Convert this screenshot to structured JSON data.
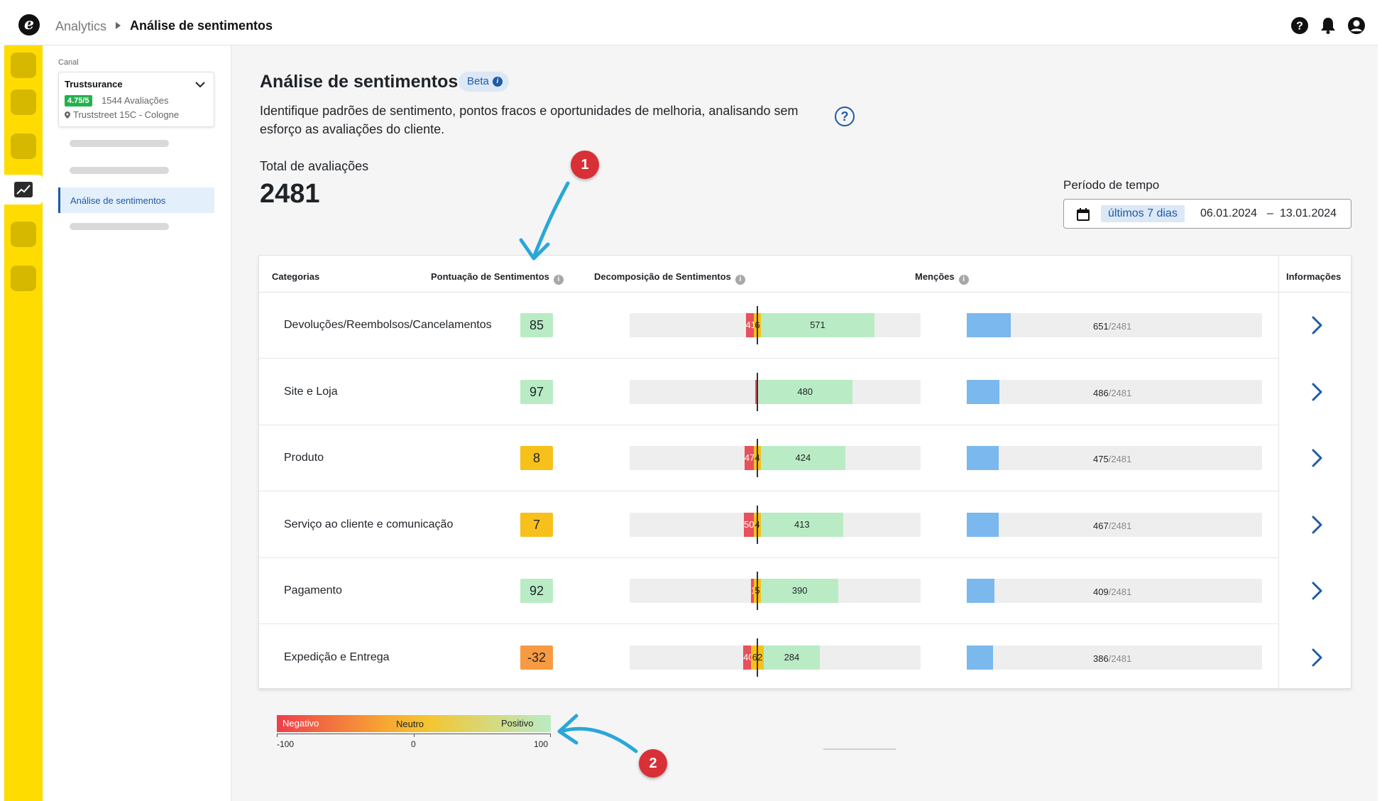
{
  "topbar": {
    "logo": "e",
    "breadcrumb": [
      "Analytics",
      "Análise de sentimentos"
    ],
    "icons": [
      "help-icon",
      "bell-icon",
      "account-icon"
    ]
  },
  "sidebar": {
    "canal_label": "Canal",
    "channel": {
      "name": "Trustsurance",
      "rating": "4.75/5",
      "reviews": "1544 Avaliações",
      "address": "Truststreet 15C - Cologne"
    },
    "active_item": "Análise de sentimentos"
  },
  "header": {
    "title": "Análise de sentimentos",
    "badge": "Beta",
    "description": "Identifique padrões de sentimento, pontos fracos e oportunidades de melhoria, analisando sem esforço as avaliações do cliente."
  },
  "summary": {
    "total_label": "Total de avaliações",
    "total_value": "2481"
  },
  "period": {
    "label": "Período de tempo",
    "preset": "últimos 7 dias",
    "start": "06.01.2024",
    "separator": "–",
    "end": "13.01.2024"
  },
  "table": {
    "headers": {
      "category": "Categorias",
      "score": "Pontuação de Sentimentos",
      "decomposition": "Decomposição de Sentimentos",
      "mentions": "Menções",
      "info": "Informações"
    },
    "rows": [
      {
        "category": "Devoluções/Reembolsos/Cancelamentos",
        "score": "85",
        "score_color": "#b9ecc4",
        "negative": 41,
        "neutral": 6,
        "positive": 571,
        "negative_label": "41",
        "neutral_label": "6",
        "positive_label": "571",
        "mentions": "651",
        "mentions_value": 651,
        "total": "/2481"
      },
      {
        "category": "Site e Loja",
        "score": "97",
        "score_color": "#b9ecc4",
        "negative": 3,
        "neutral": 0,
        "positive": 480,
        "negative_label": "",
        "neutral_label": "",
        "positive_label": "480",
        "mentions": "486",
        "mentions_value": 486,
        "total": "/2481"
      },
      {
        "category": "Produto",
        "score": "8",
        "score_color": "#f7c01b",
        "negative": 47,
        "neutral": 4,
        "positive": 424,
        "negative_label": "47",
        "neutral_label": "4",
        "positive_label": "424",
        "mentions": "475",
        "mentions_value": 475,
        "total": "/2481"
      },
      {
        "category": "Serviço ao cliente e comunicação",
        "score": "7",
        "score_color": "#f7c01b",
        "negative": 50,
        "neutral": 4,
        "positive": 413,
        "negative_label": "50",
        "neutral_label": "4",
        "positive_label": "413",
        "mentions": "467",
        "mentions_value": 467,
        "total": "/2481"
      },
      {
        "category": "Pagamento",
        "score": "92",
        "score_color": "#b9ecc4",
        "negative": 14,
        "neutral": 5,
        "positive": 390,
        "negative_label": "14",
        "neutral_label": "5",
        "positive_label": "390",
        "mentions": "409",
        "mentions_value": 409,
        "total": "/2481"
      },
      {
        "category": "Expedição e Entrega",
        "score": "-32",
        "score_color": "#f79a42",
        "negative": 40,
        "neutral": 62,
        "positive": 284,
        "negative_label": "40",
        "neutral_label": "62",
        "positive_label": "284",
        "mentions": "386",
        "mentions_value": 386,
        "total": "/2481"
      }
    ]
  },
  "legend": {
    "negative": "Negativo",
    "neutral": "Neutro",
    "positive": "Positivo",
    "min": "-100",
    "mid": "0",
    "max": "100"
  },
  "annotations": [
    "1",
    "2"
  ]
}
